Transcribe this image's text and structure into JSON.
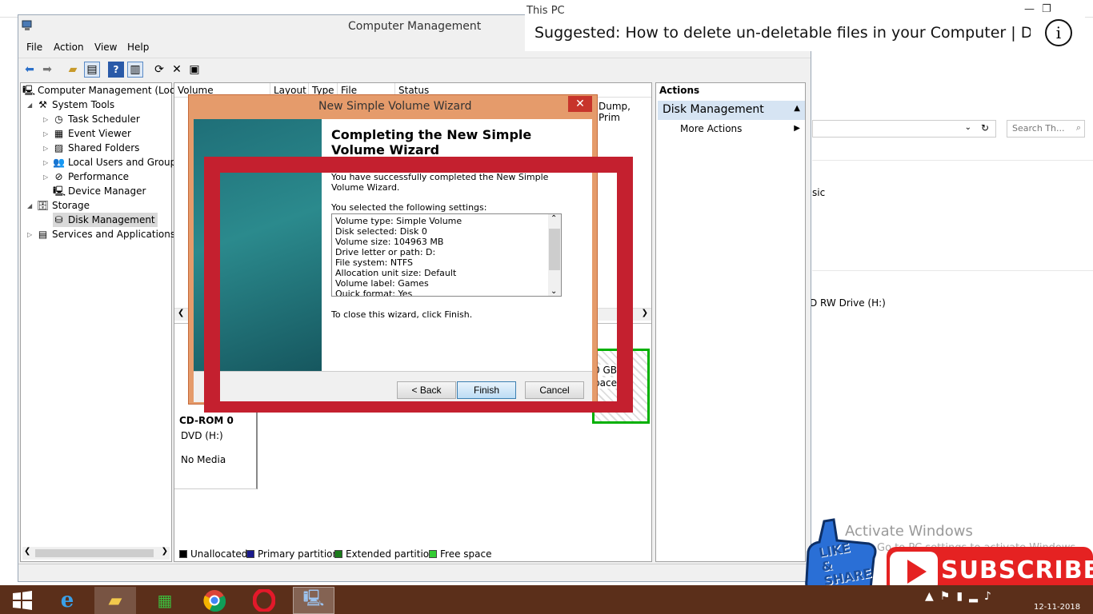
{
  "background_window": {
    "title": "This PC",
    "search_placeholder": "Search Th...",
    "text_basic": "sic",
    "text_drive": "D RW Drive (H:)"
  },
  "computer_management": {
    "title": "Computer Management",
    "menu": [
      "File",
      "Action",
      "View",
      "Help"
    ],
    "tree": [
      {
        "label": "Computer Management (Local",
        "level": 0
      },
      {
        "label": "System Tools",
        "level": 1
      },
      {
        "label": "Task Scheduler",
        "level": 2
      },
      {
        "label": "Event Viewer",
        "level": 2
      },
      {
        "label": "Shared Folders",
        "level": 2
      },
      {
        "label": "Local Users and Groups",
        "level": 2
      },
      {
        "label": "Performance",
        "level": 2
      },
      {
        "label": "Device Manager",
        "level": 2
      },
      {
        "label": "Storage",
        "level": 1
      },
      {
        "label": "Disk Management",
        "level": 2
      },
      {
        "label": "Services and Applications",
        "level": 1
      }
    ],
    "columns": [
      "Volume",
      "Layout",
      "Type",
      "File System",
      "Status"
    ],
    "status_partial": "Dump, Prim",
    "partition_text1": "0 GB",
    "partition_text2": "pace",
    "cdrom": {
      "name": "CD-ROM 0",
      "type": "DVD (H:)",
      "media": "No Media"
    },
    "legend": [
      {
        "label": "Unallocated",
        "color": "#000000"
      },
      {
        "label": "Primary partition",
        "color": "#1a1a8c"
      },
      {
        "label": "Extended partition",
        "color": "#1a7a1a"
      },
      {
        "label": "Free space",
        "color": "#33cc33"
      }
    ],
    "actions": {
      "title": "Actions",
      "section": "Disk Management",
      "more": "More Actions"
    }
  },
  "wizard": {
    "title": "New Simple Volume Wizard",
    "close_glyph": "✕",
    "heading": "Completing the New Simple Volume Wizard",
    "intro": "You have successfully completed the New Simple Volume Wizard.",
    "settings_label": "You selected the following settings:",
    "settings": [
      "Volume type: Simple Volume",
      "Disk selected: Disk 0",
      "Volume size: 104963 MB",
      "Drive letter or path: D:",
      "File system: NTFS",
      "Allocation unit size: Default",
      "Volume label: Games",
      "Quick format: Yes"
    ],
    "close_instruction": "To close this wizard, click Finish.",
    "back_label": "< Back",
    "finish_label": "Finish",
    "cancel_label": "Cancel"
  },
  "suggested": {
    "text": "Suggested: How to delete un-deletable files in your Computer | De...",
    "info_glyph": "i"
  },
  "watermark": {
    "line1": "Activate Windows",
    "line2": "Go to PC settings to activate Windows."
  },
  "badges": {
    "like_line1": "LIKE",
    "like_line2": "& SHARE",
    "subscribe": "SUBSCRIBE"
  },
  "taskbar": {
    "date": "12-11-2018"
  },
  "colors": {
    "red_overlay": "#c4202f",
    "wizard_frame": "#e59b6b",
    "actions_header": "#d6e4f3",
    "taskbar": "#5b2f1a"
  }
}
